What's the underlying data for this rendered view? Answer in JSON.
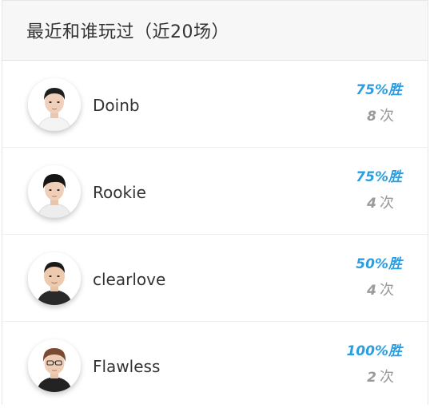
{
  "header": {
    "title": "最近和谁玩过（近20场）"
  },
  "players": [
    {
      "name": "Doinb",
      "win_rate": "75%胜",
      "games": "8",
      "games_unit": "次"
    },
    {
      "name": "Rookie",
      "win_rate": "75%胜",
      "games": "4",
      "games_unit": "次"
    },
    {
      "name": "clearlove",
      "win_rate": "50%胜",
      "games": "4",
      "games_unit": "次"
    },
    {
      "name": "Flawless",
      "win_rate": "100%胜",
      "games": "2",
      "games_unit": "次"
    }
  ],
  "colors": {
    "accent": "#2a9ee3",
    "muted": "#9a9a9a",
    "text": "#333333",
    "header_bg": "#f7f7f7"
  },
  "icons": [
    "player-avatar-icon"
  ]
}
